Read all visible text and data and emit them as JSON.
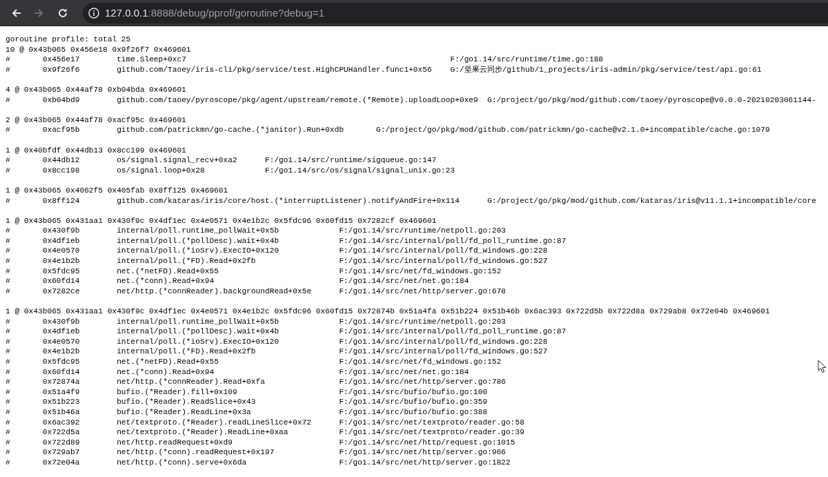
{
  "toolbar": {
    "buttons": [
      {
        "kind": "back",
        "disabled": false
      },
      {
        "kind": "forward",
        "disabled": true
      },
      {
        "kind": "reload",
        "disabled": false
      }
    ],
    "address": {
      "host": "127.0.0.1",
      "path": ":8888/debug/pprof/goroutine?debug=1"
    }
  },
  "profile": {
    "title": "goroutine profile: total 25",
    "blocks": [
      {
        "header": "10 @ 0x43b065 0x456e18 0x9f26f7 0x469601",
        "frames": [
          {
            "marker": "#",
            "pc": "0x456e17",
            "function": "time.Sleep+0xc7",
            "location": "F:/go1.14/src/runtime/time.go:188"
          },
          {
            "marker": "#",
            "pc": "0x9f26f6",
            "function": "github.com/Taoey/iris-cli/pkg/service/test.HighCPUHandler.func1+0x56",
            "location": "G:/坚果云同步/github/1_projects/iris-admin/pkg/service/test/api.go:61"
          }
        ]
      },
      {
        "header": "4 @ 0x43b065 0x44af78 0xb04bda 0x469601",
        "frames": [
          {
            "marker": "#",
            "pc": "0xb04bd9",
            "function": "github.com/taoey/pyroscope/pkg/agent/upstream/remote.(*Remote).uploadLoop+0xe9",
            "location": "G:/project/go/pkg/mod/github.com/taoey/pyroscope@v0.0.0-20210203061144-"
          }
        ]
      },
      {
        "header": "2 @ 0x43b065 0x44af78 0xacf95c 0x469601",
        "frames": [
          {
            "marker": "#",
            "pc": "0xacf95b",
            "function": "github.com/patrickmn/go-cache.(*janitor).Run+0xdb",
            "location": "G:/project/go/pkg/mod/github.com/patrickmn/go-cache@v2.1.0+incompatible/cache.go:1079"
          }
        ]
      },
      {
        "header": "1 @ 0x40bfdf 0x44db13 0x8cc199 0x469601",
        "frames": [
          {
            "marker": "#",
            "pc": "0x44db12",
            "function": "os/signal.signal_recv+0xa2",
            "location": "F:/go1.14/src/runtime/sigqueue.go:147"
          },
          {
            "marker": "#",
            "pc": "0x8cc198",
            "function": "os/signal.loop+0x28",
            "location": "F:/go1.14/src/os/signal/signal_unix.go:23"
          }
        ]
      },
      {
        "header": "1 @ 0x43b065 0x4062f5 0x405fab 0x8ff125 0x469601",
        "frames": [
          {
            "marker": "#",
            "pc": "0x8ff124",
            "function": "github.com/kataras/iris/core/host.(*interruptListener).notifyAndFire+0x114",
            "location": "G:/project/go/pkg/mod/github.com/kataras/iris@v11.1.1+incompatible/core"
          }
        ]
      },
      {
        "header": "1 @ 0x43b065 0x431aa1 0x430f9c 0x4df1ec 0x4e0571 0x4e1b2c 0x5fdc96 0x60fd15 0x7282cf 0x469601",
        "frames": [
          {
            "marker": "#",
            "pc": "0x430f9b",
            "function": "internal/poll.runtime_pollWait+0x5b",
            "location": "F:/go1.14/src/runtime/netpoll.go:203"
          },
          {
            "marker": "#",
            "pc": "0x4df1eb",
            "function": "internal/poll.(*pollDesc).wait+0x4b",
            "location": "F:/go1.14/src/internal/poll/fd_poll_runtime.go:87"
          },
          {
            "marker": "#",
            "pc": "0x4e0570",
            "function": "internal/poll.(*ioSrv).ExecIO+0x120",
            "location": "F:/go1.14/src/internal/poll/fd_windows.go:228"
          },
          {
            "marker": "#",
            "pc": "0x4e1b2b",
            "function": "internal/poll.(*FD).Read+0x2fb",
            "location": "F:/go1.14/src/internal/poll/fd_windows.go:527"
          },
          {
            "marker": "#",
            "pc": "0x5fdc95",
            "function": "net.(*netFD).Read+0x55",
            "location": "F:/go1.14/src/net/fd_windows.go:152"
          },
          {
            "marker": "#",
            "pc": "0x60fd14",
            "function": "net.(*conn).Read+0x94",
            "location": "F:/go1.14/src/net/net.go:184"
          },
          {
            "marker": "#",
            "pc": "0x7282ce",
            "function": "net/http.(*connReader).backgroundRead+0x5e",
            "location": "F:/go1.14/src/net/http/server.go:678"
          }
        ]
      },
      {
        "header": "1 @ 0x43b065 0x431aa1 0x430f9c 0x4df1ec 0x4e0571 0x4e1b2c 0x5fdc96 0x60fd15 0x72874b 0x51a4fa 0x51b224 0x51b46b 0x6ac393 0x722d5b 0x722d8a 0x729ab8 0x72e04b 0x469601",
        "frames": [
          {
            "marker": "#",
            "pc": "0x430f9b",
            "function": "internal/poll.runtime_pollWait+0x5b",
            "location": "F:/go1.14/src/runtime/netpoll.go:203"
          },
          {
            "marker": "#",
            "pc": "0x4df1eb",
            "function": "internal/poll.(*pollDesc).wait+0x4b",
            "location": "F:/go1.14/src/internal/poll/fd_poll_runtime.go:87"
          },
          {
            "marker": "#",
            "pc": "0x4e0570",
            "function": "internal/poll.(*ioSrv).ExecIO+0x120",
            "location": "F:/go1.14/src/internal/poll/fd_windows.go:228"
          },
          {
            "marker": "#",
            "pc": "0x4e1b2b",
            "function": "internal/poll.(*FD).Read+0x2fb",
            "location": "F:/go1.14/src/internal/poll/fd_windows.go:527"
          },
          {
            "marker": "#",
            "pc": "0x5fdc95",
            "function": "net.(*netFD).Read+0x55",
            "location": "F:/go1.14/src/net/fd_windows.go:152"
          },
          {
            "marker": "#",
            "pc": "0x60fd14",
            "function": "net.(*conn).Read+0x94",
            "location": "F:/go1.14/src/net/net.go:184"
          },
          {
            "marker": "#",
            "pc": "0x72874a",
            "function": "net/http.(*connReader).Read+0xfa",
            "location": "F:/go1.14/src/net/http/server.go:786"
          },
          {
            "marker": "#",
            "pc": "0x51a4f9",
            "function": "bufio.(*Reader).fill+0x109",
            "location": "F:/go1.14/src/bufio/bufio.go:100"
          },
          {
            "marker": "#",
            "pc": "0x51b223",
            "function": "bufio.(*Reader).ReadSlice+0x43",
            "location": "F:/go1.14/src/bufio/bufio.go:359"
          },
          {
            "marker": "#",
            "pc": "0x51b46a",
            "function": "bufio.(*Reader).ReadLine+0x3a",
            "location": "F:/go1.14/src/bufio/bufio.go:388"
          },
          {
            "marker": "#",
            "pc": "0x6ac392",
            "function": "net/textproto.(*Reader).readLineSlice+0x72",
            "location": "F:/go1.14/src/net/textproto/reader.go:58"
          },
          {
            "marker": "#",
            "pc": "0x722d5a",
            "function": "net/textproto.(*Reader).ReadLine+0xaa",
            "location": "F:/go1.14/src/net/textproto/reader.go:39"
          },
          {
            "marker": "#",
            "pc": "0x722d89",
            "function": "net/http.readRequest+0xd9",
            "location": "F:/go1.14/src/net/http/request.go:1015"
          },
          {
            "marker": "#",
            "pc": "0x729ab7",
            "function": "net/http.(*conn).readRequest+0x197",
            "location": "F:/go1.14/src/net/http/server.go:966"
          },
          {
            "marker": "#",
            "pc": "0x72e04a",
            "function": "net/http.(*conn).serve+0x6da",
            "location": "F:/go1.14/src/net/http/server.go:1822"
          }
        ]
      }
    ]
  }
}
